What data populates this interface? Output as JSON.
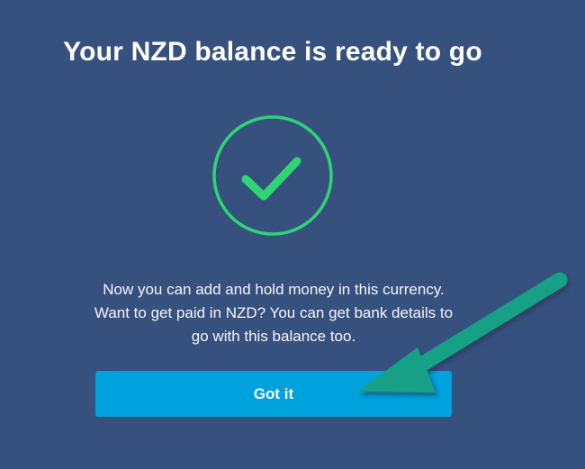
{
  "dialog": {
    "title": "Your NZD balance is ready to go",
    "message": "Now you can add and hold money in this currency. Want to get paid in NZD? You can get bank details to go with this balance too.",
    "button_label": "Got it"
  },
  "icons": {
    "success": "checkmark-circle-icon",
    "annotation": "arrow-icon"
  },
  "colors": {
    "background": "#37517e",
    "success_green": "#2ed573",
    "button_blue": "#00a2dd",
    "annotation_green": "#16a085"
  }
}
